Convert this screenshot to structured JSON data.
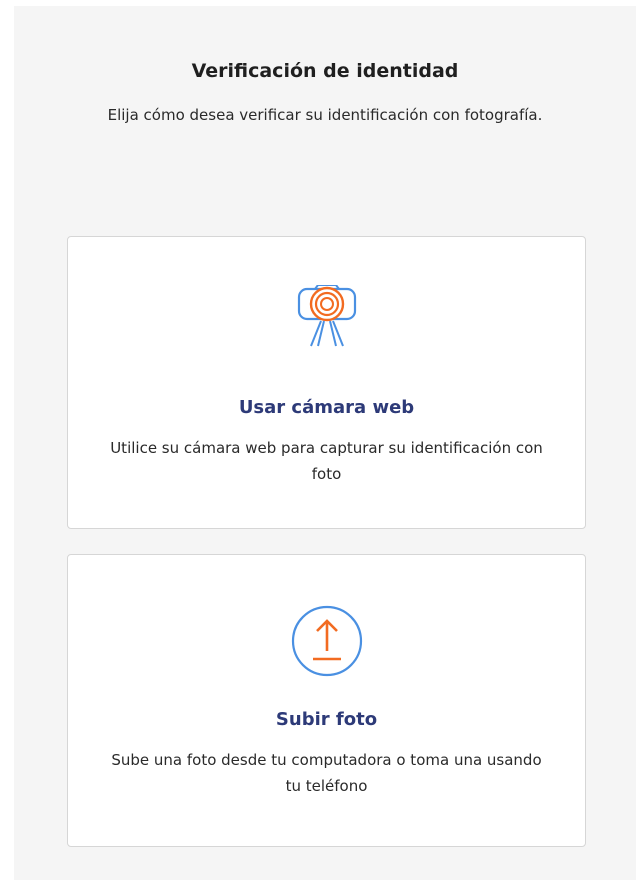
{
  "header": {
    "title": "Verificación de identidad",
    "subtitle": "Elija cómo desea verificar su identificación con fotografía."
  },
  "options": [
    {
      "icon": "webcam-icon",
      "title": "Usar cámara web",
      "description": "Utilice su cámara web para capturar su identificación con foto"
    },
    {
      "icon": "upload-icon",
      "title": "Subir foto",
      "description": "Sube una foto desde tu computadora o toma una usando tu teléfono"
    }
  ],
  "colors": {
    "icon_blue": "#4a90e2",
    "icon_orange": "#f26b21",
    "card_title": "#2d3a78",
    "panel_background": "#f5f5f5"
  }
}
